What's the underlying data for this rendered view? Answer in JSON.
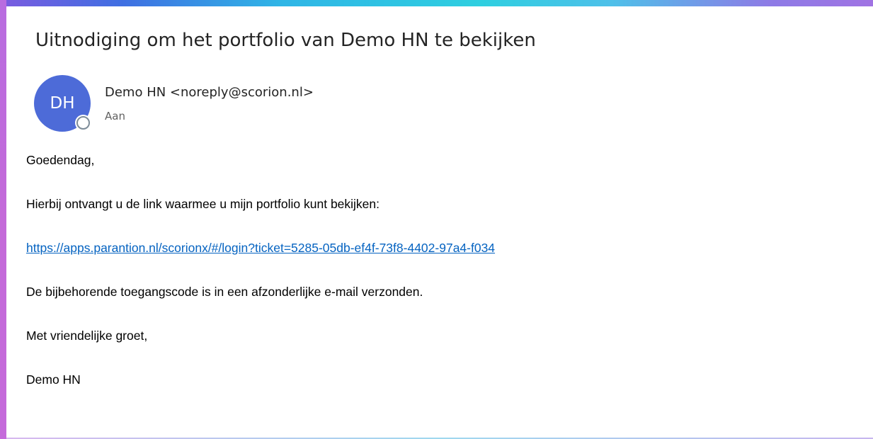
{
  "email": {
    "subject": "Uitnodiging om het portfolio van Demo HN te bekijken",
    "sender": {
      "initials": "DH",
      "display": "Demo HN <noreply@scorion.nl>",
      "avatar_color": "#4d6bd8"
    },
    "to_label": "Aan",
    "body": {
      "greeting": "Goedendag,",
      "intro": "Hierbij ontvangt u de link waarmee u mijn portfolio kunt bekijken:",
      "link": "https://apps.parantion.nl/scorionx/#/login?ticket=5285-05db-ef4f-73f8-4402-97a4-f034",
      "note": "De bijbehorende toegangscode is in een afzonderlijke e-mail verzonden.",
      "closing": "Met vriendelijke groet,",
      "signature": "Demo HN"
    }
  },
  "colors": {
    "link": "#0563c1",
    "text": "#000000",
    "accent_left": "#c46ad9"
  }
}
